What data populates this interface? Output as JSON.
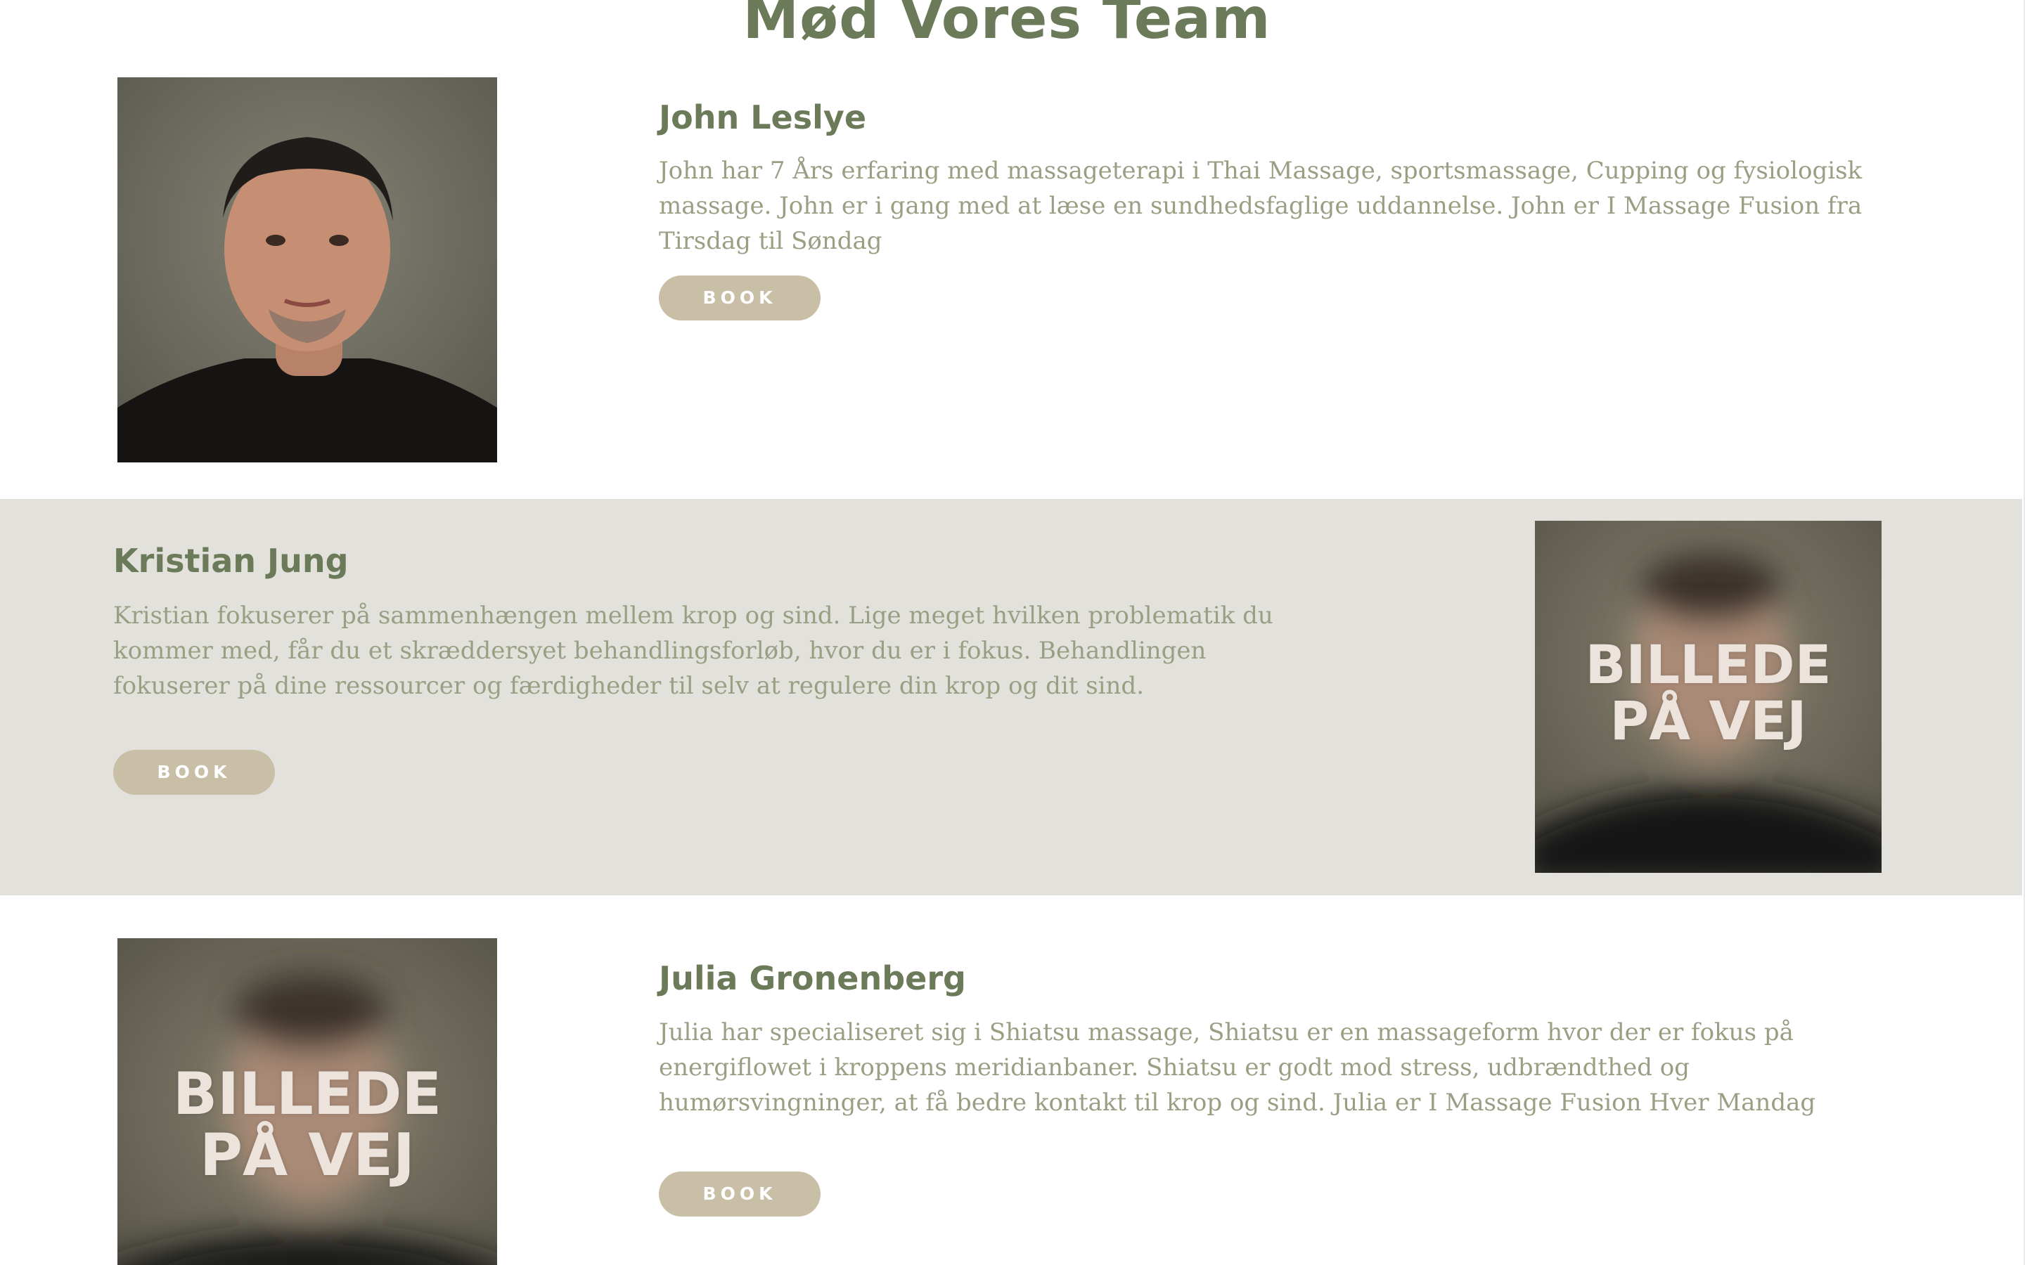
{
  "page": {
    "title": "Mød Vores Team"
  },
  "team": [
    {
      "name": "John Leslye",
      "bio": "John har 7 Års erfaring med massageterapi i Thai Massage, sportsmassage, Cupping og fysiologisk massage. John er i gang med at læse en sundhedsfaglige uddannelse. John er I Massage Fusion fra Tirsdag til Søndag",
      "button": "BOOK",
      "photo": "portrait-photo"
    },
    {
      "name": "Kristian Jung",
      "bio": "Kristian fokuserer på sammenhængen mellem krop og sind. Lige meget hvilken problematik du kommer med, får du et skræddersyet behandlingsforløb, hvor du er i fokus. Behandlingen fokuserer på dine ressourcer og færdigheder til selv at regulere din krop og dit sind.",
      "button": "BOOK",
      "placeholder": [
        "BILLEDE",
        "PÅ VEJ"
      ]
    },
    {
      "name": "Julia Gronenberg",
      "bio": "Julia har specialiseret sig i Shiatsu massage, Shiatsu er en massageform hvor der er fokus på energiflowet i kroppens meridianbaner. Shiatsu er godt mod stress, udbrændthed og humørsvingninger, at få bedre kontakt til krop og sind. Julia er I Massage Fusion Hver Mandag",
      "button": "BOOK",
      "placeholder": [
        "BILLEDE",
        "PÅ VEJ"
      ]
    }
  ],
  "colors": {
    "heading": "#6b7a58",
    "text": "#9a9f84",
    "button": "#c9bfa6",
    "band": "#e2e1db"
  }
}
